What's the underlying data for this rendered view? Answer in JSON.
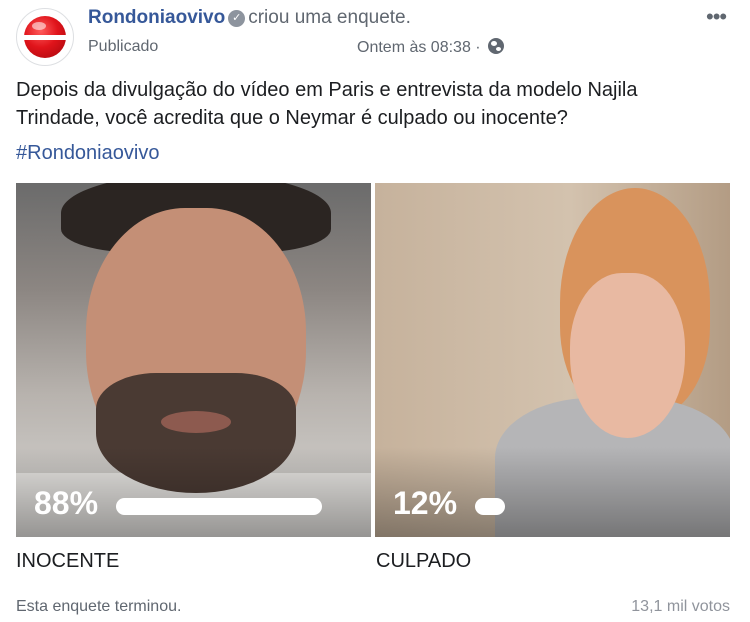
{
  "post": {
    "author": "Rondoniaovivo",
    "action": "criou uma enquete.",
    "status": "Publicado",
    "timestamp": "Ontem às 08:38 ·",
    "more_label": "•••",
    "text": "Depois da divulgação do vídeo em Paris e entrevista da modelo Najila Trindade, você acredita que o Neymar é culpado ou inocente?",
    "hashtag": "#Rondoniaovivo"
  },
  "poll": {
    "options": [
      {
        "label": "INOCENTE",
        "percent_text": "88%",
        "percent": 88
      },
      {
        "label": "CULPADO",
        "percent_text": "12%",
        "percent": 12
      }
    ],
    "status": "Esta enquete terminou.",
    "votes": "13,1 mil votos"
  },
  "colors": {
    "link": "#365899",
    "secondary_text": "#606770",
    "brand_red": "#e0141b"
  },
  "icons": {
    "verified": "verified-badge-icon",
    "privacy": "globe-icon",
    "more": "more-options-icon"
  }
}
